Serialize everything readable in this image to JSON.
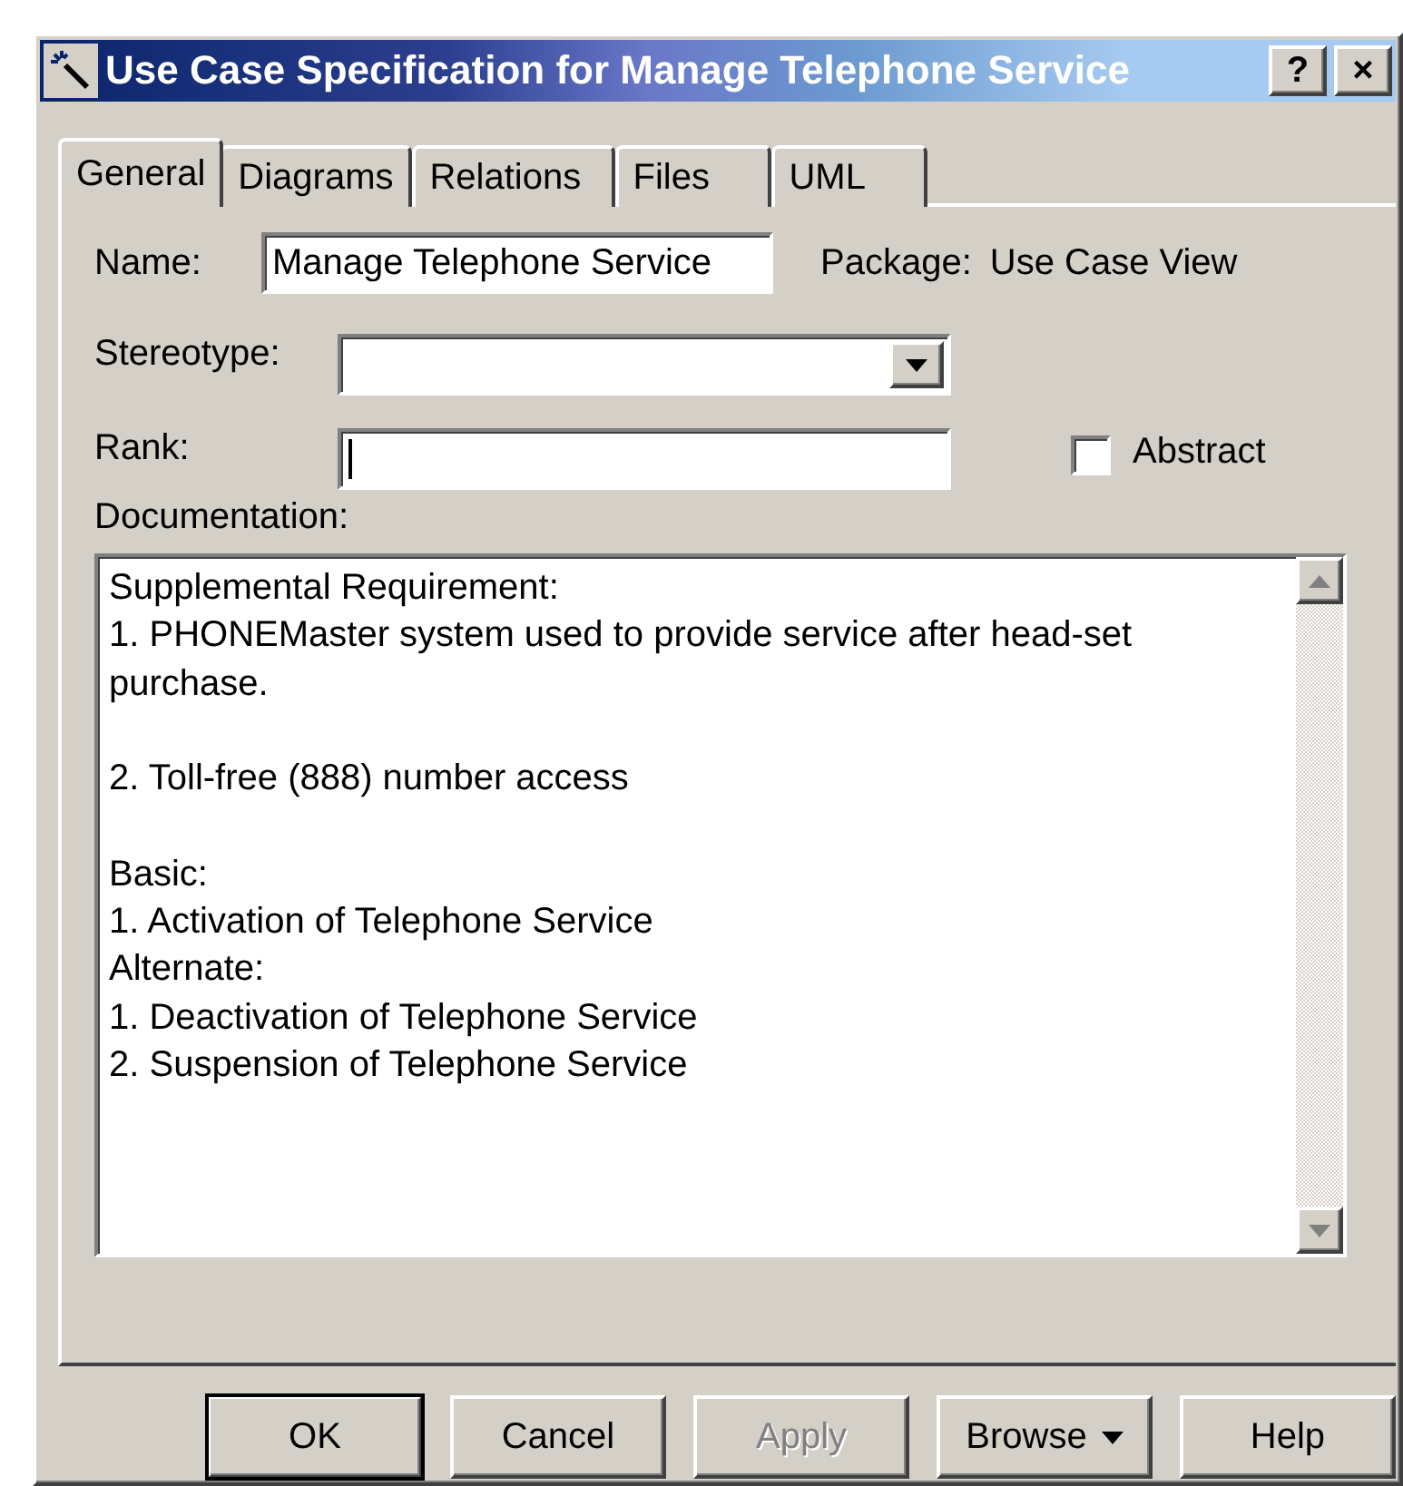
{
  "window": {
    "title": "Use Case Specification for Manage Telephone Service",
    "title_buttons": [
      "?",
      "×"
    ]
  },
  "tabs": [
    {
      "label": "General",
      "selected": true
    },
    {
      "label": "Diagrams",
      "selected": false
    },
    {
      "label": "Relations",
      "selected": false
    },
    {
      "label": "Files",
      "selected": false
    },
    {
      "label": "UML",
      "selected": false
    }
  ],
  "form": {
    "name_label": "Name:",
    "name_value": "Manage Telephone Service",
    "package_label": "Package:",
    "package_value": "Use Case View",
    "stereotype_label": "Stereotype:",
    "rank_label": "Rank:",
    "rank_focused": true,
    "abstract": {
      "label": "Abstract",
      "checked": false
    },
    "documentation_label": "Documentation:",
    "documentation": "Supplemental Requirement:\n1. PHONEMaster system used to provide service after head-set purchase.\n\n2. Toll-free (888) number access\n\nBasic:\n1. Activation of Telephone Service\nAlternate:\n1. Deactivation of Telephone Service\n2. Suspension of Telephone Service"
  },
  "buttons": [
    {
      "label": "OK",
      "default": true,
      "disabled": false,
      "kind": "plain"
    },
    {
      "label": "Cancel",
      "default": false,
      "disabled": false,
      "kind": "plain"
    },
    {
      "label": "Apply",
      "default": false,
      "disabled": true,
      "kind": "plain"
    },
    {
      "label": "Browse",
      "default": false,
      "disabled": false,
      "kind": "menu"
    },
    {
      "label": "Help",
      "default": false,
      "disabled": false,
      "kind": "plain"
    }
  ]
}
